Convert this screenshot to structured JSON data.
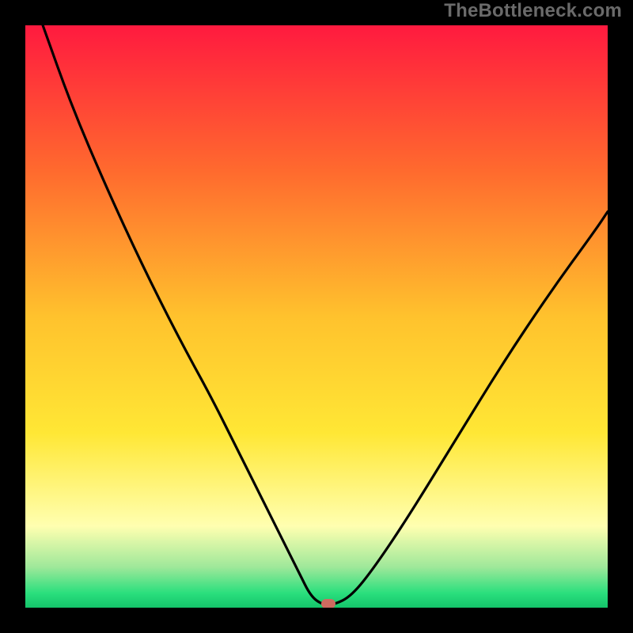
{
  "watermark": "TheBottleneck.com",
  "colors": {
    "black": "#000000",
    "red_top": "#ff1a3f",
    "orange": "#ff8a2a",
    "yellow": "#ffe735",
    "pale_yellow": "#ffffb0",
    "green": "#2adf7d",
    "green_strong": "#14c46a",
    "curve": "#000000",
    "marker": "#cd6b60",
    "watermark_text": "#6a6a6a"
  },
  "chart_data": {
    "type": "line",
    "title": "",
    "xlabel": "",
    "ylabel": "",
    "xlim": [
      0,
      100
    ],
    "ylim": [
      0,
      100
    ],
    "series": [
      {
        "name": "bottleneck-curve",
        "x": [
          3,
          8,
          14,
          20,
          26,
          32,
          36,
          40,
          44,
          47,
          49,
          51,
          53,
          56,
          60,
          66,
          74,
          82,
          90,
          98,
          100
        ],
        "y": [
          100,
          86,
          72,
          59,
          47,
          36,
          28,
          20,
          12,
          6,
          2,
          0.5,
          0.5,
          2,
          7,
          16,
          29,
          42,
          54,
          65,
          68
        ]
      }
    ],
    "flat_segment": {
      "x_start": 49,
      "x_end": 53,
      "y": 0.5
    },
    "marker": {
      "x": 52,
      "y": 0.7
    },
    "background_gradient": {
      "orientation": "vertical",
      "stops": [
        {
          "pos": 0.0,
          "color": "#ff1a3f"
        },
        {
          "pos": 0.25,
          "color": "#ff6a2e"
        },
        {
          "pos": 0.5,
          "color": "#ffc22d"
        },
        {
          "pos": 0.7,
          "color": "#ffe735"
        },
        {
          "pos": 0.86,
          "color": "#ffffb0"
        },
        {
          "pos": 0.93,
          "color": "#9fe89a"
        },
        {
          "pos": 0.975,
          "color": "#2adf7d"
        },
        {
          "pos": 1.0,
          "color": "#14c46a"
        }
      ]
    }
  }
}
